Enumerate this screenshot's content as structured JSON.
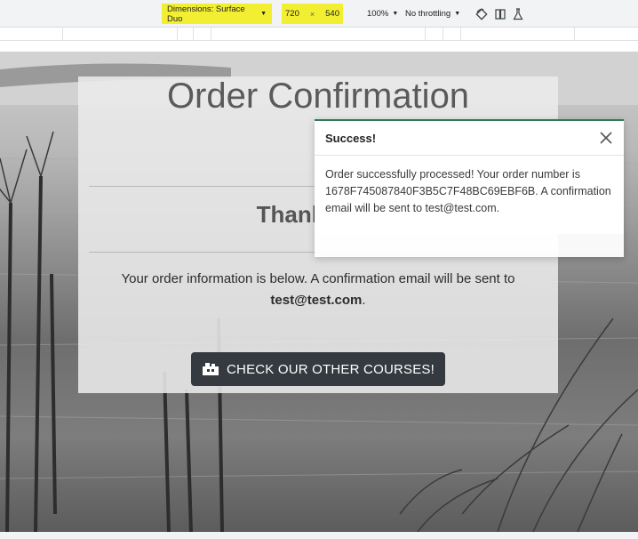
{
  "devtools": {
    "dimensions_label": "Dimensions: Surface Duo",
    "width": "720",
    "times": "×",
    "height": "540",
    "zoom": "100%",
    "throttling": "No throttling",
    "highlight_color": "#f2ee32",
    "icons": [
      "rotate-icon",
      "dual-screen-icon",
      "sensor-icon",
      "caret-down-icon"
    ]
  },
  "page": {
    "title": "Order Confirmation",
    "thanks_heading": "Thank you!",
    "info_text": "Your order information is below. A confirmation email will be sent to",
    "email": "test@test.com",
    "period": ".",
    "courses_button": "CHECK OUR OTHER COURSES!",
    "button_color": "#343a40"
  },
  "toast": {
    "title": "Success!",
    "message": "Order successfully processed! Your order number is 1678F745087840F3B5C7F48BC69EBF6B. A confirmation email will be sent to test@test.com.",
    "accent_color": "#2e7d4f",
    "close_icon": "close-icon"
  }
}
